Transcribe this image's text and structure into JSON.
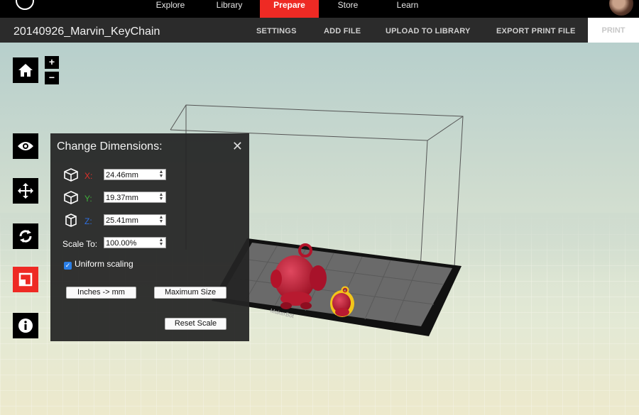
{
  "top_nav": {
    "items": [
      {
        "label": "Explore",
        "active": false
      },
      {
        "label": "Library",
        "active": false
      },
      {
        "label": "Prepare",
        "active": true
      },
      {
        "label": "Store",
        "active": false
      },
      {
        "label": "Learn",
        "active": false
      }
    ]
  },
  "toolbar": {
    "project_title": "20140926_Marvin_KeyChain",
    "settings": "SETTINGS",
    "add_file": "ADD FILE",
    "upload": "UPLOAD TO LIBRARY",
    "export": "EXPORT PRINT FILE",
    "print": "PRINT"
  },
  "zoom": {
    "plus": "+",
    "minus": "−"
  },
  "panel": {
    "title": "Change Dimensions:",
    "close": "✕",
    "x_label": "X:",
    "x_value": "24.46mm",
    "y_label": "Y:",
    "y_value": "19.37mm",
    "z_label": "Z:",
    "z_value": "25.41mm",
    "scale_label": "Scale To:",
    "scale_value": "100.00%",
    "uniform_label": "Uniform scaling",
    "uniform_checked": true,
    "inches_btn": "Inches -> mm",
    "max_btn": "Maximum Size",
    "reset_btn": "Reset Scale"
  },
  "build_plate_label": "MakerBot",
  "colors": {
    "accent": "#ee2a24",
    "model": "#c0172f",
    "selection": "#f2c51a",
    "axis_x": "#e0302a",
    "axis_y": "#3fae3a",
    "axis_z": "#2f6fe0"
  },
  "icons": [
    "home-icon",
    "view-eye-icon",
    "move-icon",
    "rotate-icon",
    "scale-icon",
    "info-icon",
    "close-icon"
  ]
}
